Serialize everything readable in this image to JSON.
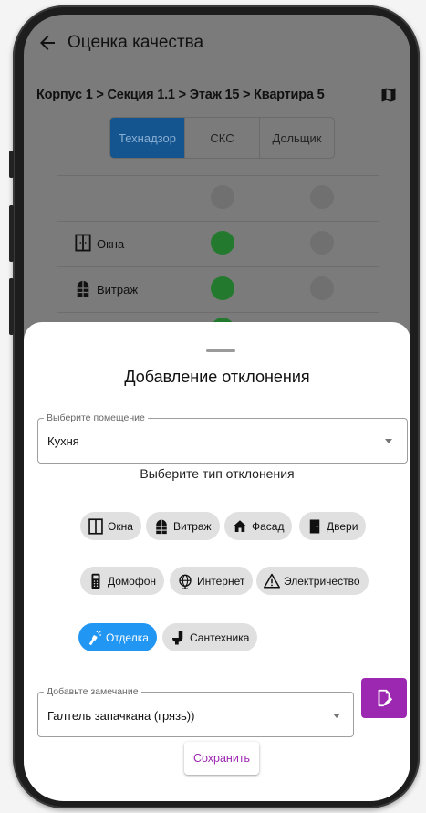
{
  "appbar": {
    "title": "Оценка качества"
  },
  "breadcrumb": "Корпус 1 > Секция 1.1 > Этаж 15 > Квартира 5",
  "tabs": [
    {
      "label": "Технадзор",
      "active": true
    },
    {
      "label": "СКС",
      "active": false
    },
    {
      "label": "Дольщик",
      "active": false
    }
  ],
  "table_rows": [
    {
      "label": "Окна",
      "icon": "window-icon",
      "status_1": "green",
      "status_2": "grey"
    },
    {
      "label": "Витраж",
      "icon": "stained-glass-icon",
      "status_1": "green",
      "status_2": "grey"
    }
  ],
  "sheet": {
    "title": "Добавление отклонения",
    "room_field": {
      "legend": "Выберите помещение",
      "value": "Кухня"
    },
    "type_label": "Выберите тип отклонения",
    "chips": [
      {
        "label": "Окна",
        "icon": "window-icon",
        "selected": false
      },
      {
        "label": "Витраж",
        "icon": "stained-glass-icon",
        "selected": false
      },
      {
        "label": "Фасад",
        "icon": "house-icon",
        "selected": false
      },
      {
        "label": "Двери",
        "icon": "door-icon",
        "selected": false
      },
      {
        "label": "Домофон",
        "icon": "intercom-icon",
        "selected": false
      },
      {
        "label": "Интернет",
        "icon": "globe-icon",
        "selected": false
      },
      {
        "label": "Электричество",
        "icon": "warning-icon",
        "selected": false
      },
      {
        "label": "Отделка",
        "icon": "paint-sprayer-icon",
        "selected": true
      },
      {
        "label": "Сантехника",
        "icon": "toilet-icon",
        "selected": false
      }
    ],
    "note_field": {
      "legend": "Добавьте замечание",
      "value": "Галтель запачкана (грязь))"
    },
    "save_label": "Сохранить"
  },
  "colors": {
    "tab_active": "#15558f",
    "status_green": "#237a2e",
    "status_grey": "#707070",
    "chip_selected": "#2196f3",
    "accent": "#9c27b0"
  }
}
